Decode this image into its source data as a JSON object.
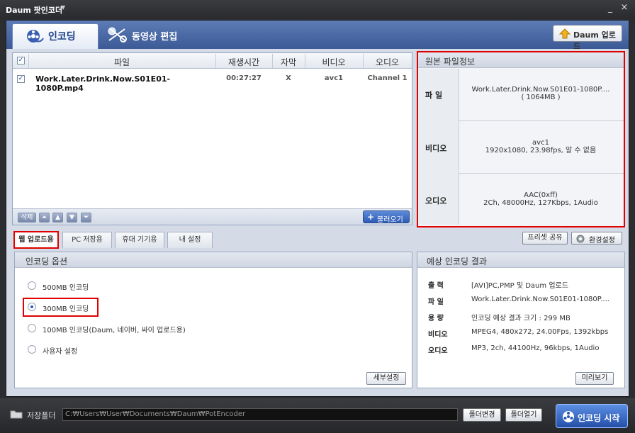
{
  "window": {
    "title": "Daum 팟인코더",
    "min": "_",
    "close": "×"
  },
  "tabs": {
    "encode": "인코딩",
    "edit": "동영상 편집"
  },
  "header": {
    "daum_upload": "Daum 업로드"
  },
  "file_list": {
    "columns": {
      "file": "파일",
      "duration": "재생시간",
      "subtitle": "자막",
      "video": "비디오",
      "audio": "오디오"
    },
    "rows": [
      {
        "checked": true,
        "file": "Work.Later.Drink.Now.S01E01-1080P.mp4",
        "duration": "00:27:27",
        "subtitle": "X",
        "video": "avc1",
        "audio": "Channel 1"
      }
    ],
    "delete_label": "삭제",
    "load_label": "불러오기"
  },
  "source_info": {
    "title": "원본 파일정보",
    "file_label": "파 일",
    "file_name": "Work.Later.Drink.Now.S01E01-1080P....",
    "file_size": "( 1064MB )",
    "video_label": "비디오",
    "video_codec": "avc1",
    "video_detail": "1920x1080, 23.98fps, 알 수 없음",
    "audio_label": "오디오",
    "audio_codec": "AAC(0xff)",
    "audio_detail": "2Ch, 48000Hz, 127Kbps, 1Audio"
  },
  "preset_tabs": [
    "웹 업로드용",
    "PC 저장용",
    "휴대 기기용",
    "내 설정"
  ],
  "preset_buttons": {
    "share": "프리셋 공유",
    "env": "환경설정"
  },
  "encoding_options": {
    "title": "인코딩 옵션",
    "options": [
      "500MB 인코딩",
      "300MB 인코딩",
      "100MB 인코딩(Daum, 네이버, 싸이 업로드용)",
      "사용자 설정"
    ],
    "selected": "300MB 인코딩",
    "detail_button": "세부설정"
  },
  "expected_result": {
    "title": "예상 인코딩 결과",
    "rows": [
      {
        "key": "출 력",
        "value": "[AVI]PC,PMP 및 Daum 업로드"
      },
      {
        "key": "파 일",
        "value": "Work.Later.Drink.Now.S01E01-1080P...."
      },
      {
        "key": "용 량",
        "value": "인코딩 예상 결과 크기 : 299 MB"
      },
      {
        "key": "비디오",
        "value": "MPEG4, 480x272, 24.00Fps, 1392kbps"
      },
      {
        "key": "오디오",
        "value": "MP3, 2ch, 44100Hz, 96kbps, 1Audio"
      }
    ],
    "preview_button": "미리보기"
  },
  "bottom": {
    "save_folder_label": "저장폴더",
    "save_path": "C:₩Users₩User₩Documents₩Daum₩PotEncoder",
    "folder_change": "폴더변경",
    "folder_open": "폴더열기",
    "start": "인코딩 시작"
  }
}
